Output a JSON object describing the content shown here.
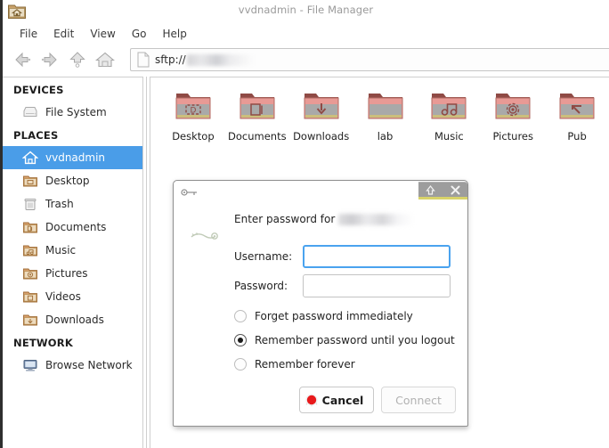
{
  "window": {
    "title": "vvdnadmin - File Manager",
    "app_icon": "home-folder-icon"
  },
  "menubar": {
    "items": [
      {
        "label": "File"
      },
      {
        "label": "Edit"
      },
      {
        "label": "View"
      },
      {
        "label": "Go"
      },
      {
        "label": "Help"
      }
    ]
  },
  "toolbar": {
    "buttons": [
      {
        "name": "back-button",
        "icon": "arrow-left-icon"
      },
      {
        "name": "forward-button",
        "icon": "arrow-right-icon"
      },
      {
        "name": "up-button",
        "icon": "arrow-up-icon"
      },
      {
        "name": "home-button",
        "icon": "home-icon"
      }
    ],
    "path": {
      "icon": "document-icon",
      "scheme": "sftp://",
      "host_redacted": true
    }
  },
  "sidebar": {
    "groups": [
      {
        "title": "DEVICES",
        "items": [
          {
            "label": "File System",
            "icon": "harddisk-icon",
            "selected": false
          }
        ]
      },
      {
        "title": "PLACES",
        "items": [
          {
            "label": "vvdnadmin",
            "icon": "home-icon",
            "selected": true
          },
          {
            "label": "Desktop",
            "icon": "folder-desktop-icon",
            "selected": false
          },
          {
            "label": "Trash",
            "icon": "trash-icon",
            "selected": false
          },
          {
            "label": "Documents",
            "icon": "folder-documents-icon",
            "selected": false
          },
          {
            "label": "Music",
            "icon": "folder-music-icon",
            "selected": false
          },
          {
            "label": "Pictures",
            "icon": "folder-pictures-icon",
            "selected": false
          },
          {
            "label": "Videos",
            "icon": "folder-videos-icon",
            "selected": false
          },
          {
            "label": "Downloads",
            "icon": "folder-downloads-icon",
            "selected": false
          }
        ]
      },
      {
        "title": "NETWORK",
        "items": [
          {
            "label": "Browse Network",
            "icon": "network-monitor-icon",
            "selected": false
          }
        ]
      }
    ]
  },
  "content": {
    "files": [
      {
        "label": "Desktop",
        "icon": "folder-desktop-icon"
      },
      {
        "label": "Documents",
        "icon": "folder-documents-icon"
      },
      {
        "label": "Downloads",
        "icon": "folder-downloads-icon"
      },
      {
        "label": "lab",
        "icon": "folder-icon"
      },
      {
        "label": "Music",
        "icon": "folder-music-icon"
      },
      {
        "label": "Pictures",
        "icon": "folder-pictures-icon"
      },
      {
        "label": "Pub",
        "icon": "folder-public-icon"
      }
    ]
  },
  "dialog": {
    "titlebar": {
      "key_icon": "key-icon",
      "restore_button": "restore-up-icon",
      "close_button": "close-x-icon"
    },
    "side_icon": "key-icon",
    "prompt": "Enter password for",
    "host_redacted": true,
    "fields": [
      {
        "label": "Username:",
        "value": "",
        "focused": true
      },
      {
        "label": "Password:",
        "value": "",
        "focused": false
      }
    ],
    "radios": [
      {
        "label": "Forget password immediately",
        "checked": false
      },
      {
        "label": "Remember password until you logout",
        "checked": true
      },
      {
        "label": "Remember forever",
        "checked": false
      }
    ],
    "buttons": [
      {
        "label": "Cancel",
        "icon": "stop-icon",
        "disabled": false
      },
      {
        "label": "Connect",
        "icon": null,
        "disabled": true
      }
    ]
  },
  "colors": {
    "selection_blue": "#4a9de8",
    "focus_border": "#4aa3ef",
    "title_grey": "#9a9a9a",
    "dialog_title_bar": "#9d9d9d",
    "dialog_accent": "#d8d36a",
    "cancel_red": "#e8191b"
  }
}
